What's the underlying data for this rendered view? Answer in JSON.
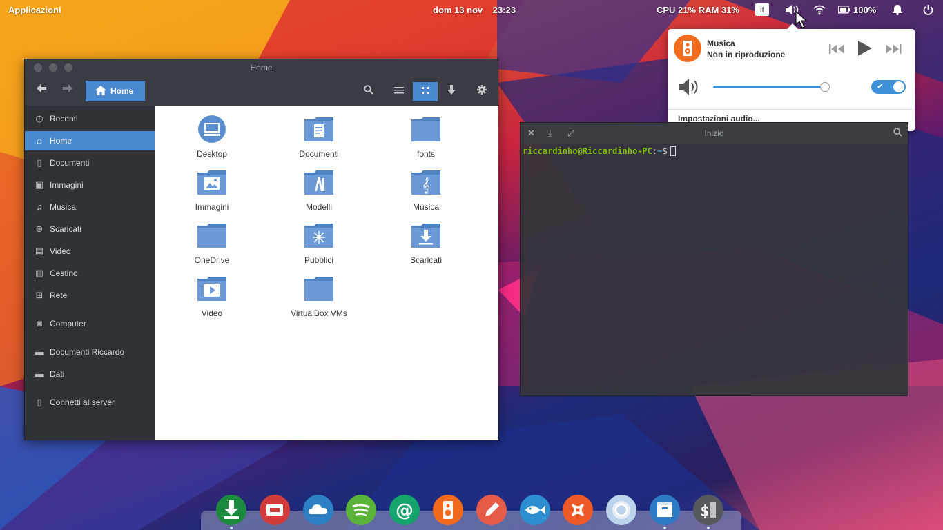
{
  "topbar": {
    "applications": "Applicazioni",
    "datetime": "dom 13 nov    23:23",
    "system_monitor": "CPU 21% RAM 31%",
    "keyboard_layout": "it",
    "battery": "100%"
  },
  "sound_popover": {
    "player_name": "Musica",
    "player_status": "Non in riproduzione",
    "volume_percent": 100,
    "output_enabled": true,
    "settings_link": "Impostazioni audio..."
  },
  "file_manager": {
    "window_title": "Home",
    "path_button": "Home",
    "sidebar": [
      {
        "label": "Recenti"
      },
      {
        "label": "Home"
      },
      {
        "label": "Documenti"
      },
      {
        "label": "Immagini"
      },
      {
        "label": "Musica"
      },
      {
        "label": "Scaricati"
      },
      {
        "label": "Video"
      },
      {
        "label": "Cestino"
      },
      {
        "label": "Rete"
      },
      {
        "label": "Computer"
      },
      {
        "label": "Documenti Riccardo"
      },
      {
        "label": "Dati"
      },
      {
        "label": "Connetti al server"
      }
    ],
    "items": [
      {
        "label": "Desktop",
        "icon": "desktop-icon"
      },
      {
        "label": "Documenti",
        "icon": "documents-folder-icon"
      },
      {
        "label": "fonts",
        "icon": "folder-icon"
      },
      {
        "label": "Immagini",
        "icon": "pictures-folder-icon"
      },
      {
        "label": "Modelli",
        "icon": "templates-folder-icon"
      },
      {
        "label": "Musica",
        "icon": "music-folder-icon"
      },
      {
        "label": "OneDrive",
        "icon": "folder-icon"
      },
      {
        "label": "Pubblici",
        "icon": "public-folder-icon"
      },
      {
        "label": "Scaricati",
        "icon": "downloads-folder-icon"
      },
      {
        "label": "Video",
        "icon": "videos-folder-icon"
      },
      {
        "label": "VirtualBox VMs",
        "icon": "folder-icon"
      }
    ]
  },
  "terminal": {
    "title": "Inizio",
    "prompt_user": "riccardinho@Riccardinho-PC",
    "prompt_sep": ":",
    "prompt_path": "~",
    "prompt_symbol": "$"
  },
  "dock": [
    {
      "name": "downloader-icon",
      "color": "#1c8a3c"
    },
    {
      "name": "screenshot-icon",
      "color": "#d23b3b"
    },
    {
      "name": "onedrive-icon",
      "color": "#2b7fc2"
    },
    {
      "name": "spotify-icon",
      "color": "#5bb43a"
    },
    {
      "name": "mail-icon",
      "color": "#14a36b"
    },
    {
      "name": "music-player-icon",
      "color": "#f26b1d"
    },
    {
      "name": "pencil-icon",
      "color": "#e55b47"
    },
    {
      "name": "fish-icon",
      "color": "#2d8fd0"
    },
    {
      "name": "xampp-icon",
      "color": "#f05a28"
    },
    {
      "name": "chrome-icon",
      "color": "#bcd3ec"
    },
    {
      "name": "files-icon",
      "color": "#2d79c4"
    },
    {
      "name": "terminal-icon",
      "color": "#55585d"
    }
  ],
  "colors": {
    "accent": "#4a89d0",
    "sidebar_bg": "#2f3237",
    "header_bg": "#393c42",
    "terminal_user": "#7fbf00",
    "terminal_path": "#3f9fdf"
  }
}
